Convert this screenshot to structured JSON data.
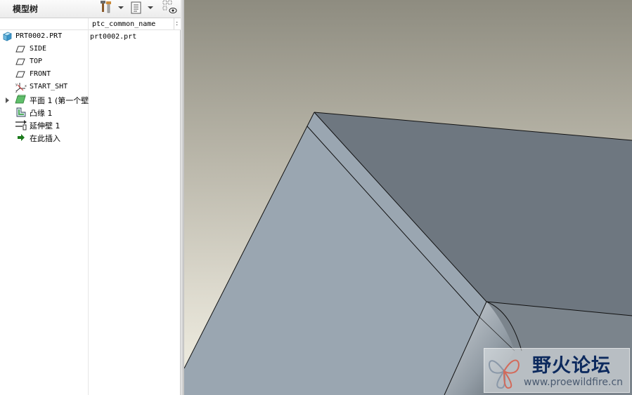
{
  "panel": {
    "title": "模型树",
    "columns": [
      "ptc_common_name"
    ],
    "more_columns_glyph": ":"
  },
  "tree": {
    "root": {
      "label": "PRT0002.PRT",
      "icon": "part-icon",
      "common_name": "prt0002.prt"
    },
    "items": [
      {
        "label": "SIDE",
        "icon": "datum-plane-icon"
      },
      {
        "label": "TOP",
        "icon": "datum-plane-icon"
      },
      {
        "label": "FRONT",
        "icon": "datum-plane-icon"
      },
      {
        "label": "START_SHT",
        "icon": "coordinate-system-icon"
      },
      {
        "label": "平面 1 (第一个壁",
        "icon": "sheetmetal-planar-wall-icon",
        "expandable": true
      },
      {
        "label": "凸缘 1",
        "icon": "flange-wall-icon"
      },
      {
        "label": "延伸壁 1",
        "icon": "extend-wall-icon"
      },
      {
        "label": "在此插入",
        "icon": "insert-here-arrow-icon"
      }
    ]
  },
  "watermark": {
    "title": "野火论坛",
    "url": "www.proewildfire.cn"
  },
  "colors": {
    "viewport_top": "#8e8c80",
    "viewport_bottom": "#f2f0e4",
    "face_light": "#9aa6b1",
    "face_dark": "#6e7780",
    "edge": "#111111",
    "insert_arrow": "#1c7a1c"
  }
}
